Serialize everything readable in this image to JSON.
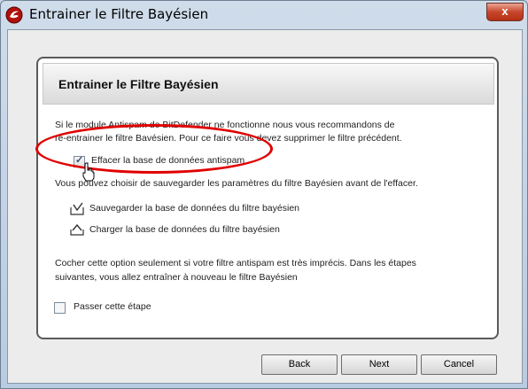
{
  "window": {
    "title": "Entrainer le Filtre Bayésien",
    "close_glyph": "x"
  },
  "panel": {
    "title": "Entrainer le Filtre Bayésien",
    "intro_line1": "Si le module Antispam de BitDefender ne fonctionne nous vous recommandons de",
    "intro_line2": "ré-entrainer le filtre Bavésien. Pour ce faire vous devez supprimer le filtre précédent.",
    "erase_checkbox": {
      "label": "Effacer la base de données antispam",
      "checked": true
    },
    "save_hint": "Vous pouvez choisir de sauvegarder les paramètres du filtre Bayésien avant de l'effacer.",
    "save_link": "Sauvegarder la base de données du filtre bayésien",
    "load_link": "Charger la base de données du filtre bayésien",
    "note_line1": "Cocher cette option seulement si votre filtre antispam est très imprécis. Dans les étapes",
    "note_line2": "suivantes, vous allez entraîner à nouveau le filtre Bayésien",
    "skip_checkbox": {
      "label": "Passer cette étape",
      "checked": false
    }
  },
  "buttons": {
    "back": "Back",
    "next": "Next",
    "cancel": "Cancel"
  },
  "colors": {
    "highlight_ellipse": "#e00000",
    "close_button": "#c7462b"
  },
  "icons": [
    "bitdefender-logo-icon",
    "save-database-icon",
    "load-database-icon",
    "hand-cursor-icon"
  ]
}
